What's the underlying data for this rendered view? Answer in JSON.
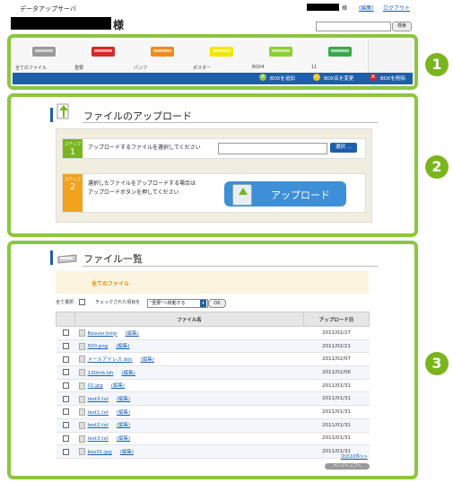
{
  "header": {
    "app_title": "データアップサーバ",
    "user_suffix": "様",
    "account_suffix": "様",
    "edit_link": "(編集)",
    "logout_link": "ログアウト",
    "search_button": "検索"
  },
  "boxes": [
    {
      "label": "全てのファイル",
      "color": "#9a9a9a"
    },
    {
      "label": "重要",
      "color": "#d32a2a"
    },
    {
      "label": "パンフ",
      "color": "#f08a1c"
    },
    {
      "label": "ポスター",
      "color": "#f2e600"
    },
    {
      "label": "BOX4",
      "color": "#8cd12f"
    },
    {
      "label": "11",
      "color": "#3aa84a"
    }
  ],
  "box_actions": {
    "add": "BOXを追加",
    "rename": "BOX名を変更",
    "delete": "BOXを削除"
  },
  "markers": [
    "1",
    "2",
    "3"
  ],
  "upload": {
    "title": "ファイルのアップロード",
    "step_label": "ステップ",
    "step1_num": "1",
    "step1_text": "アップロードするファイルを選択してください",
    "select_button": "選択 ...",
    "step2_num": "2",
    "step2_line1": "選択したファイルをアップロードする場合は",
    "step2_line2": "アップロードボタンを押してください",
    "upload_button": "アップロード"
  },
  "files": {
    "title": "ファイル一覧",
    "current_box": "全てのファイル",
    "select_all": "全て選択",
    "move_label": "チェックされた項目を",
    "move_select": "\"重要\"へ移動する",
    "ok_button": "OK",
    "col_name": "ファイル名",
    "col_date": "アップロード日",
    "edit_label": "(編集)",
    "rows": [
      {
        "name": "Beaver.bmp",
        "date": "2011/02/27"
      },
      {
        "name": "500.png",
        "date": "2011/02/21"
      },
      {
        "name": "メールアドレス.doc",
        "date": "2011/02/07"
      },
      {
        "name": "130mb.lzh",
        "date": "2011/02/06"
      },
      {
        "name": "02.jpg",
        "date": "2011/01/31"
      },
      {
        "name": "test3.txt",
        "date": "2011/01/31"
      },
      {
        "name": "test1.txt",
        "date": "2011/01/31"
      },
      {
        "name": "test2.txt",
        "date": "2011/01/31"
      },
      {
        "name": "test3.txt",
        "date": "2011/01/31"
      },
      {
        "name": "box01.jpg",
        "date": "2011/01/31"
      }
    ],
    "next_link": "次の10件>>",
    "pagetop": "ページトップへ"
  },
  "colors": {
    "frame_green": "#8cc63f",
    "brand_blue": "#1f5eab",
    "step1_green": "#7ab51d",
    "step2_orange": "#f2a21c"
  }
}
